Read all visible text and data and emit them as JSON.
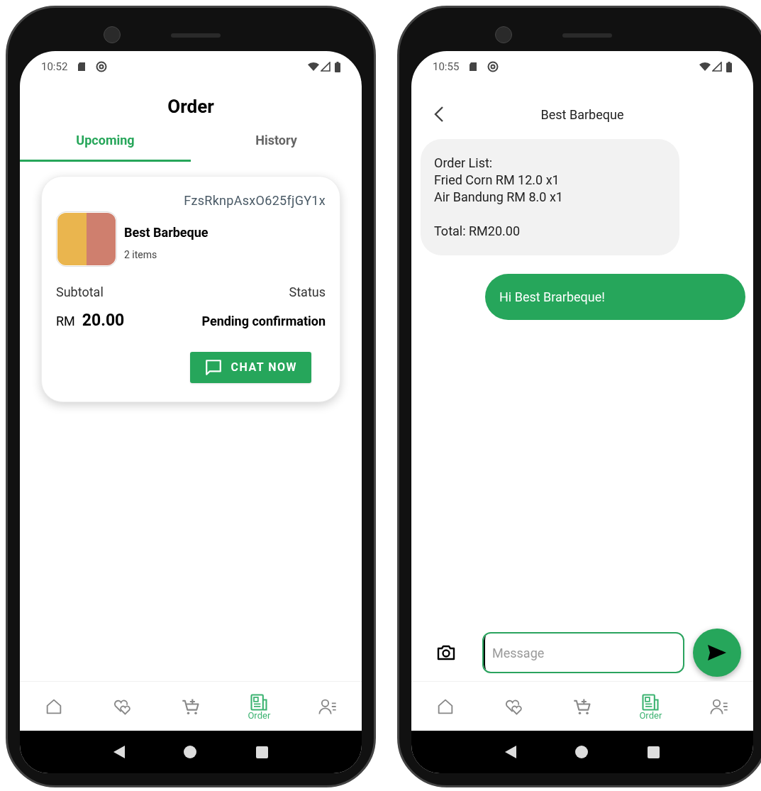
{
  "phones": [
    {
      "kind": "orders",
      "status_bar": {
        "time": "10:52"
      },
      "title": "Order",
      "tabs": [
        {
          "label": "Upcoming",
          "selected": true
        },
        {
          "label": "History",
          "selected": false
        }
      ],
      "order_card": {
        "order_id": "FzsRknpAsxO625fjGY1x",
        "restaurant": "Best Barbeque",
        "item_count": "2 items",
        "subtotal_label": "Subtotal",
        "currency": "RM",
        "subtotal": "20.00",
        "status_label": "Status",
        "status": "Pending confirmation",
        "chat_button": "CHAT NOW"
      },
      "bottom_nav": [
        {
          "kind": "home",
          "selected": false
        },
        {
          "kind": "favorites",
          "selected": false
        },
        {
          "kind": "cart",
          "selected": false
        },
        {
          "kind": "order",
          "label": "Order",
          "selected": true
        },
        {
          "kind": "profile",
          "selected": false
        }
      ]
    },
    {
      "kind": "chat",
      "status_bar": {
        "time": "10:55"
      },
      "title": "Best Barbeque",
      "messages": [
        {
          "kind": "received",
          "text": "Order List:\nFried Corn RM 12.0 x1\nAir Bandung RM 8.0 x1\n\nTotal: RM20.00"
        },
        {
          "kind": "sent",
          "text": "Hi Best Brarbeque!"
        }
      ],
      "composer": {
        "placeholder": "Message",
        "focused": true
      },
      "bottom_nav": [
        {
          "kind": "home",
          "selected": false
        },
        {
          "kind": "favorites",
          "selected": false
        },
        {
          "kind": "cart",
          "selected": false
        },
        {
          "kind": "order",
          "label": "Order",
          "selected": true
        },
        {
          "kind": "profile",
          "selected": false
        }
      ]
    }
  ]
}
